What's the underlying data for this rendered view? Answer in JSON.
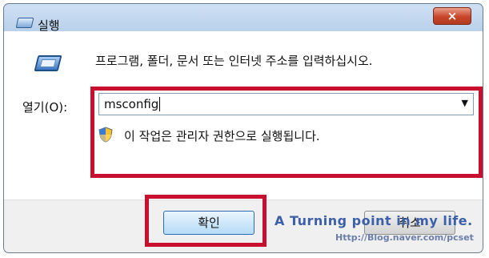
{
  "window": {
    "title": "실행",
    "close_symbol": "×"
  },
  "main": {
    "description": "프로그램, 폴더, 문서 또는 인터넷 주소를 입력하십시오.",
    "open_label": "열기(O):",
    "input_value": "msconfig",
    "dropdown_symbol": "▼",
    "admin_note": "이 작업은 관리자 권한으로 실행됩니다."
  },
  "buttons": {
    "ok_label": "확인",
    "cancel_label": "취소"
  },
  "watermark": {
    "line1": "A Turning point in my life.",
    "line2": "Http://Blog.naver.com/pcset"
  },
  "icons": {
    "title": "run-icon",
    "main": "run-icon",
    "shield": "shield-icon",
    "close": "close-icon",
    "dropdown": "chevron-down-icon"
  },
  "colors": {
    "highlight": "#c8102e",
    "titlebar": "#cfe0f3",
    "close_button": "#c7462a"
  }
}
